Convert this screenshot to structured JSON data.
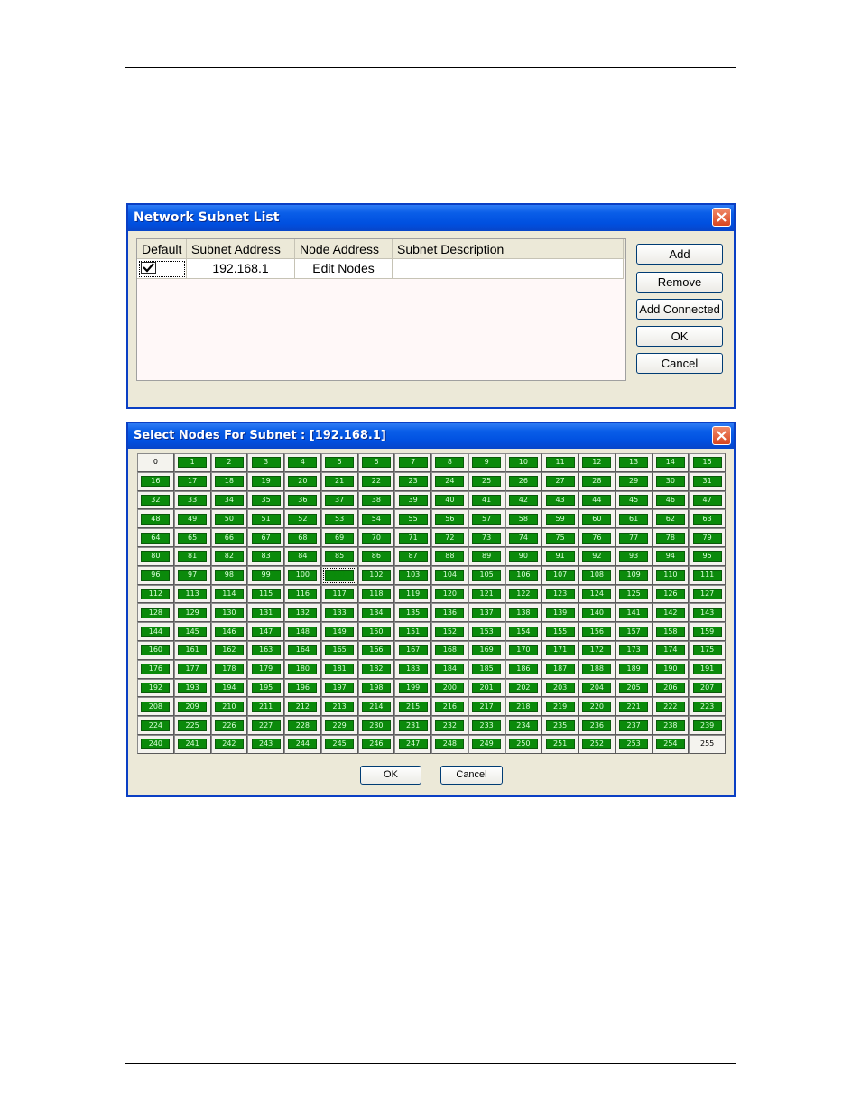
{
  "subnet_dialog": {
    "title": "Network Subnet List",
    "columns": [
      "Default",
      "Subnet Address",
      "Node Address",
      "Subnet Description"
    ],
    "rows": [
      {
        "default_checked": true,
        "subnet_address": "192.168.1",
        "node_address": "Edit Nodes",
        "description": ""
      }
    ],
    "buttons": {
      "add": "Add",
      "remove": "Remove",
      "add_connected": "Add Connected",
      "ok": "OK",
      "cancel": "Cancel"
    }
  },
  "node_dialog": {
    "title": "Select Nodes For Subnet : [192.168.1]",
    "node_count": 256,
    "unselected_nodes": [
      0,
      255
    ],
    "focused_node": 101,
    "selected_color": "#0b8a0b",
    "buttons": {
      "ok": "OK",
      "cancel": "Cancel"
    }
  }
}
